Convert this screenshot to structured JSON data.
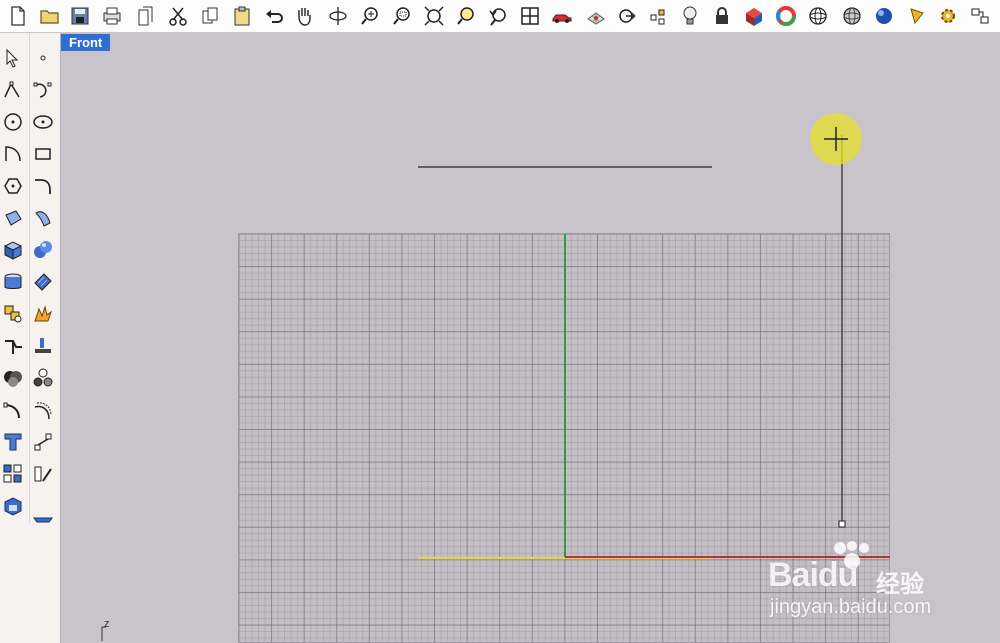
{
  "viewport": {
    "title": "Front",
    "axis_label": "z"
  },
  "toolbar": {
    "icons": [
      "new-file-icon",
      "open-folder-icon",
      "save-icon",
      "print-icon",
      "copy-document-icon",
      "cut-icon",
      "copy-icon",
      "paste-icon",
      "undo-icon",
      "pan-hand-icon",
      "rotate-view-icon",
      "zoom-in-icon",
      "zoom-window-icon",
      "zoom-extents-icon",
      "zoom-selected-icon",
      "undo-view-icon",
      "four-viewports-icon",
      "car-icon",
      "grid-plane-icon",
      "gumball-icon",
      "point-highlight-icon",
      "light-bulb-icon",
      "lock-icon",
      "shade-icon",
      "color-wheel-icon",
      "wireframe-sphere-icon",
      "grid-sphere-icon",
      "render-sphere-icon",
      "pen-icon",
      "settings-gear-icon",
      "snap-toggle-icon"
    ]
  },
  "sidebar": {
    "tools": [
      "select-icon",
      "point-icon",
      "polyline-icon",
      "curve-icon",
      "circle-icon",
      "ellipse-icon",
      "arc-icon",
      "rectangle-icon",
      "polygon-icon",
      "fillet-curve-icon",
      "surface-icon",
      "sweep-surface-icon",
      "box-solid-icon",
      "sphere-solid-icon",
      "cylinder-solid-icon",
      "plane-surface-icon",
      "transform-icon",
      "explode-icon",
      "split-icon",
      "trim-icon",
      "boolean-icon",
      "boolean-split-icon",
      "fillet-icon",
      "offset-icon",
      "text-icon",
      "dimension-icon",
      "array-icon",
      "orient-icon",
      "solid-tools-icon",
      "layout-icon"
    ]
  },
  "watermark": {
    "brand": "Baidu",
    "cn": "经验",
    "url": "jingyan.baidu.com"
  },
  "colors": {
    "viewport_bg": "#c9c3cc",
    "grid_bg": "#c4bfc5",
    "x_axis": "#b5342b",
    "y_axis": "#2f9a48",
    "yellow_line": "#e8d445",
    "tab_bg": "#2f6fd1"
  }
}
